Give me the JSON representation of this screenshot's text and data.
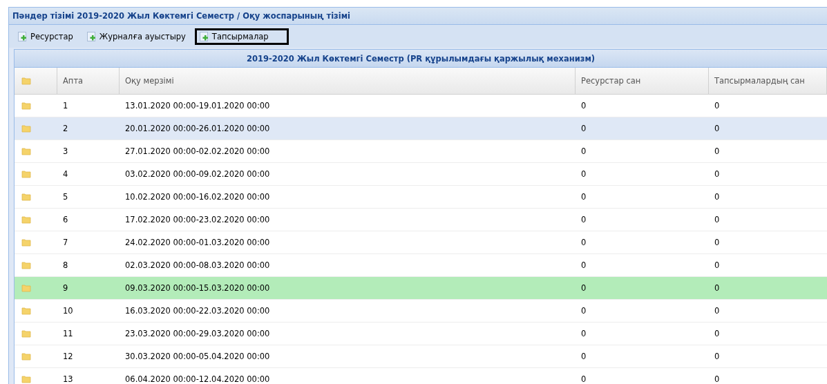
{
  "panel": {
    "title": "Пәндер тізімі 2019-2020 Жыл Көктемгі Семестр / Оқу жоспарының тізімі"
  },
  "toolbar": [
    {
      "label": "Ресурстар",
      "outlined": false
    },
    {
      "label": "Журналға ауыстыру",
      "outlined": false
    },
    {
      "label": "Тапсырмалар",
      "outlined": true
    }
  ],
  "table": {
    "group_title": "2019-2020 Жыл Көктемгі Семестр (PR құрылымдағы қаржылық механизм)",
    "columns": [
      "Апта",
      "Оқу мерзімі",
      "Ресурстар сан",
      "Тапсырмалардың сан"
    ],
    "rows": [
      {
        "cells": [
          "1",
          "13.01.2020 00:00-19.01.2020 00:00",
          "0",
          "0"
        ],
        "selected": false,
        "current": false
      },
      {
        "cells": [
          "2",
          "20.01.2020 00:00-26.01.2020 00:00",
          "0",
          "0"
        ],
        "selected": true,
        "current": false
      },
      {
        "cells": [
          "3",
          "27.01.2020 00:00-02.02.2020 00:00",
          "0",
          "0"
        ],
        "selected": false,
        "current": false
      },
      {
        "cells": [
          "4",
          "03.02.2020 00:00-09.02.2020 00:00",
          "0",
          "0"
        ],
        "selected": false,
        "current": false
      },
      {
        "cells": [
          "5",
          "10.02.2020 00:00-16.02.2020 00:00",
          "0",
          "0"
        ],
        "selected": false,
        "current": false
      },
      {
        "cells": [
          "6",
          "17.02.2020 00:00-23.02.2020 00:00",
          "0",
          "0"
        ],
        "selected": false,
        "current": false
      },
      {
        "cells": [
          "7",
          "24.02.2020 00:00-01.03.2020 00:00",
          "0",
          "0"
        ],
        "selected": false,
        "current": false
      },
      {
        "cells": [
          "8",
          "02.03.2020 00:00-08.03.2020 00:00",
          "0",
          "0"
        ],
        "selected": false,
        "current": false
      },
      {
        "cells": [
          "9",
          "09.03.2020 00:00-15.03.2020 00:00",
          "0",
          "0"
        ],
        "selected": false,
        "current": true
      },
      {
        "cells": [
          "10",
          "16.03.2020 00:00-22.03.2020 00:00",
          "0",
          "0"
        ],
        "selected": false,
        "current": false
      },
      {
        "cells": [
          "11",
          "23.03.2020 00:00-29.03.2020 00:00",
          "0",
          "0"
        ],
        "selected": false,
        "current": false
      },
      {
        "cells": [
          "12",
          "30.03.2020 00:00-05.04.2020 00:00",
          "0",
          "0"
        ],
        "selected": false,
        "current": false
      },
      {
        "cells": [
          "13",
          "06.04.2020 00:00-12.04.2020 00:00",
          "0",
          "0"
        ],
        "selected": false,
        "current": false
      }
    ]
  }
}
